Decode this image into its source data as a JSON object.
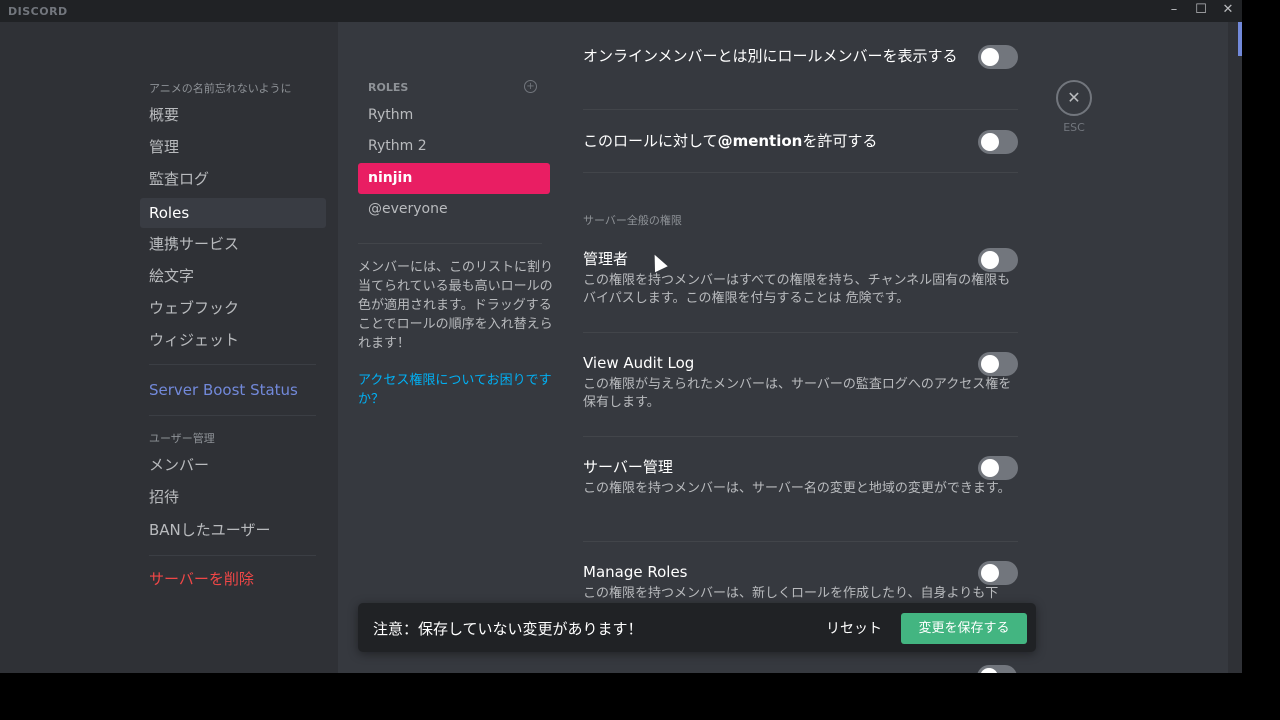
{
  "titlebar": {
    "logo": "DISCORD",
    "minimize": "–",
    "maximize": "☐",
    "close": "✕"
  },
  "sidebar": {
    "server_header": "アニメの名前忘れないように",
    "items": [
      {
        "label": "概要"
      },
      {
        "label": "管理"
      },
      {
        "label": "監査ログ"
      },
      {
        "label": "Roles",
        "selected": true
      },
      {
        "label": "連携サービス"
      },
      {
        "label": "絵文字"
      },
      {
        "label": "ウェブフック"
      },
      {
        "label": "ウィジェット"
      }
    ],
    "boost": "Server Boost Status",
    "user_header": "ユーザー管理",
    "user_items": [
      {
        "label": "メンバー"
      },
      {
        "label": "招待"
      },
      {
        "label": "BANしたユーザー"
      }
    ],
    "delete": "サーバーを削除"
  },
  "roles": {
    "header": "ROLES",
    "add_icon": "plus-circle-icon",
    "items": [
      {
        "label": "Rythm"
      },
      {
        "label": "Rythm 2"
      },
      {
        "label": "ninjin",
        "selected": true,
        "color": "#e91e63"
      },
      {
        "label": "@everyone"
      }
    ],
    "hint": "メンバーには、このリストに割り当てられている最も高いロールの色が適用されます。ドラッグすることでロールの順序を入れ替えられます！",
    "help_link": "アクセス権限についてお困りですか？"
  },
  "settings": {
    "display_separately": {
      "label": "オンラインメンバーとは別にロールメンバーを表示する",
      "enabled": false
    },
    "mentionable": {
      "label_pre": "このロールに対して",
      "label_bold": "@mention",
      "label_post": "を許可する",
      "enabled": false
    },
    "section": "サーバー全般の権限",
    "perms": [
      {
        "title": "管理者",
        "desc": "この権限を持つメンバーはすべての権限を持ち、チャンネル固有の権限もバイパスします。この権限を付与することは 危険です。",
        "enabled": false
      },
      {
        "title": "View Audit Log",
        "desc": "この権限が与えられたメンバーは、サーバーの監査ログへのアクセス権を保有します。",
        "enabled": false
      },
      {
        "title": "サーバー管理",
        "desc": "この権限を持つメンバーは、サーバー名の変更と地域の変更ができます。",
        "enabled": false
      },
      {
        "title": "Manage Roles",
        "desc": "この権限を持つメンバーは、新しくロールを作成したり、自身よりも下",
        "enabled": false
      }
    ]
  },
  "esc": {
    "label": "ESC",
    "icon": "close-icon"
  },
  "notice": {
    "text": "注意：保存していない変更があります！",
    "reset": "リセット",
    "save": "変更を保存する",
    "save_color": "#43b581"
  }
}
